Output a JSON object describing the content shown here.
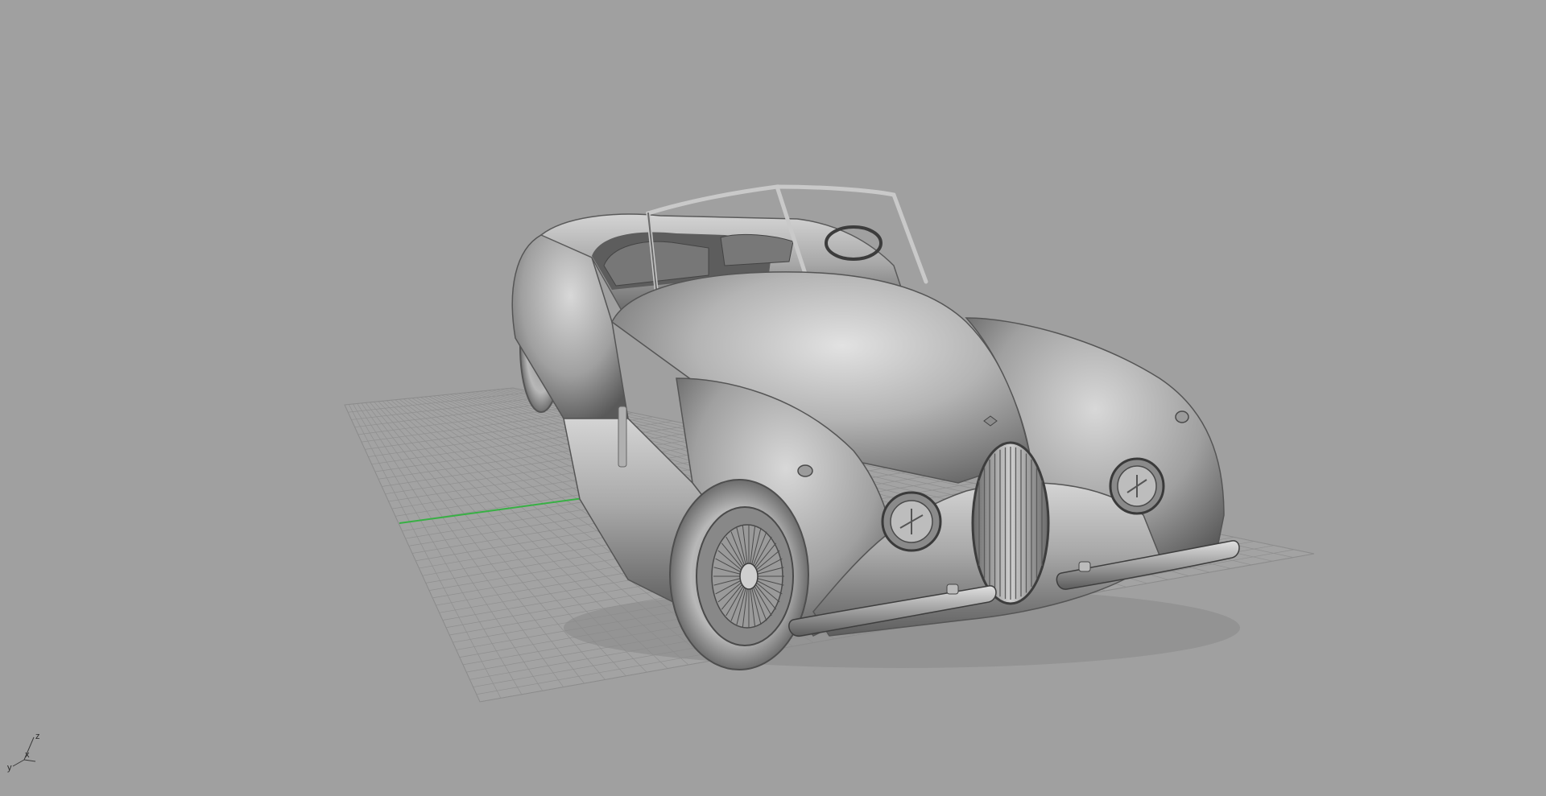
{
  "viewport": {
    "type": "3D perspective viewport",
    "display_mode": "shaded",
    "background_color": "#a0a0a0",
    "grid_color": "#8e8e8e",
    "x_axis_color": "#38b044"
  },
  "model": {
    "icon": "roadster-car-model",
    "color": "#b4b4b4"
  },
  "axis_widget": {
    "labels": [
      "z",
      "x",
      "y"
    ]
  }
}
